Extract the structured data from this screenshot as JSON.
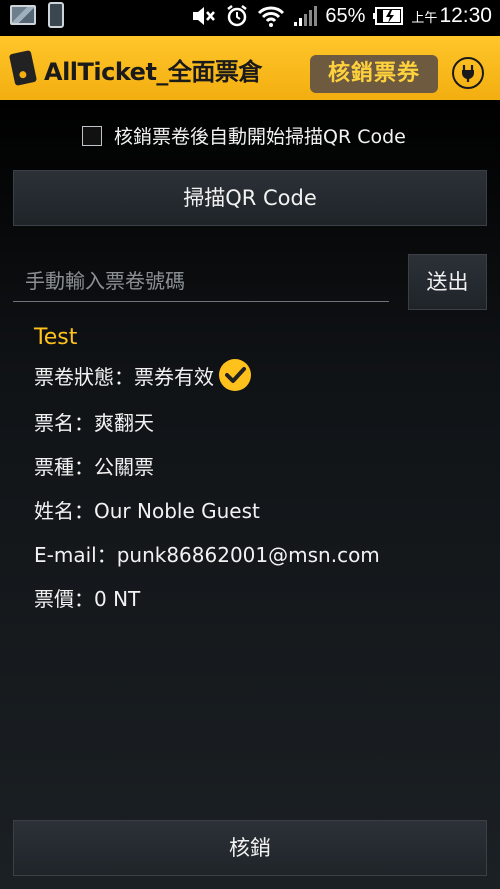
{
  "status_bar": {
    "battery": "65%",
    "ampm": "上午",
    "time": "12:30",
    "icons": [
      "gallery-icon",
      "phone-icon",
      "mute-icon",
      "alarm-icon",
      "wifi-icon",
      "signal-icon",
      "battery-icon"
    ]
  },
  "header": {
    "logo_text": "AllTicket_全面票倉",
    "mode_label": "核銷票券",
    "plug_icon": "plug-icon",
    "background": "#f5b316"
  },
  "auto_scan": {
    "label": "核銷票卷後自動開始掃描QR Code",
    "checked": false
  },
  "scan_button": "掃描QR Code",
  "ticket_input": {
    "placeholder": "手動輸入票卷號碼",
    "value": ""
  },
  "submit_button": "送出",
  "ticket_info": {
    "title": "Test",
    "status": "票卷狀態：票券有效",
    "status_icon": "check-circle-icon",
    "accent": "#ffc21c",
    "name": "票名：爽翻天",
    "type": "票種：公關票",
    "guest": "姓名：Our Noble Guest",
    "email": "E-mail：punk86862001@msn.com",
    "price": "票價：0 NT"
  },
  "verify_button": "核銷"
}
